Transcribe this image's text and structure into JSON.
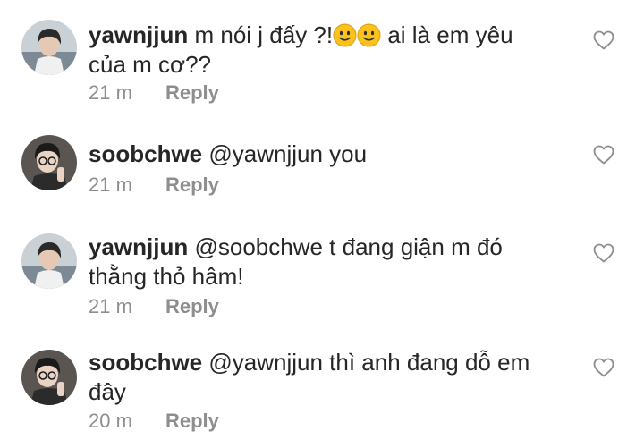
{
  "comments": [
    {
      "username": "yawnjjun",
      "text_before_emoji": "m nói j đấy ?!",
      "emoji": "slightly-smiling-face-icon",
      "emoji_count": 2,
      "text_after_emoji": " ai là em yêu của m cơ??",
      "time": "21 m",
      "reply_label": "Reply",
      "avatar_colors": {
        "bg": "#c9d1d6",
        "hair": "#2a2a2a",
        "skin": "#e6c9b4",
        "shirt": "#f0f0f0"
      }
    },
    {
      "username": "soobchwe",
      "text": "@yawnjjun you",
      "time": "21 m",
      "reply_label": "Reply",
      "avatar_colors": {
        "bg": "#5a5550",
        "hair": "#1a1a1a",
        "skin": "#e8d3c4",
        "shirt": "#2b2b2b"
      }
    },
    {
      "username": "yawnjjun",
      "text": "@soobchwe t đang giận m đó thằng thỏ hâm!",
      "time": "21 m",
      "reply_label": "Reply",
      "avatar_colors": {
        "bg": "#c9d1d6",
        "hair": "#2a2a2a",
        "skin": "#e6c9b4",
        "shirt": "#f0f0f0"
      }
    },
    {
      "username": "soobchwe",
      "text": "@yawnjjun thì anh đang dỗ em đây",
      "time": "20 m",
      "reply_label": "Reply",
      "avatar_colors": {
        "bg": "#5a5550",
        "hair": "#1a1a1a",
        "skin": "#e8d3c4",
        "shirt": "#2b2b2b"
      }
    }
  ],
  "icons": {
    "like": "heart-outline-icon"
  },
  "colors": {
    "text": "#262626",
    "muted": "#8e8e8e",
    "emoji_face": "#fcc21b"
  }
}
